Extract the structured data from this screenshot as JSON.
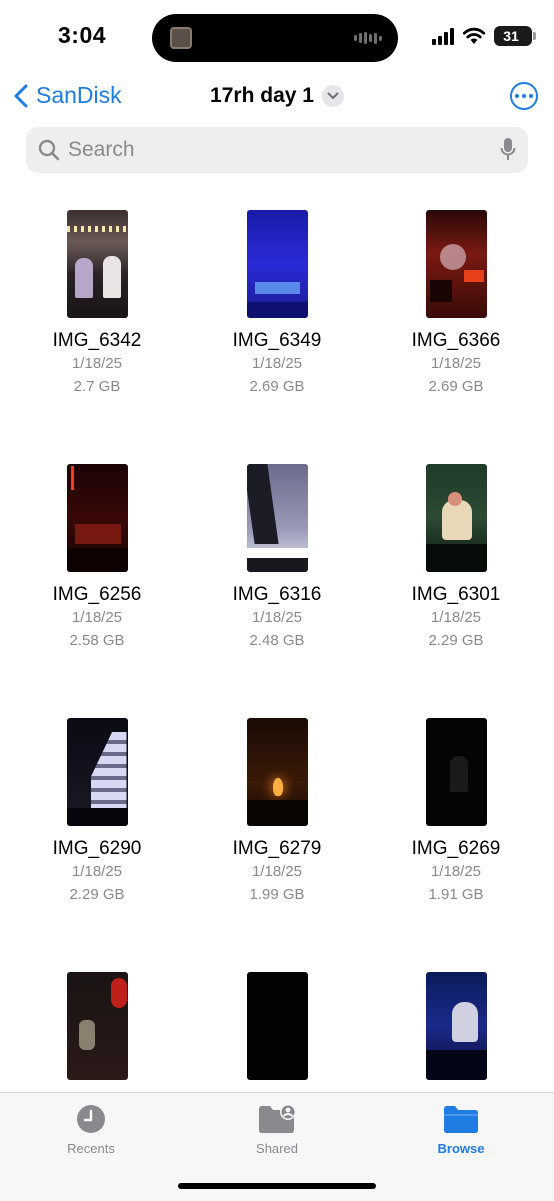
{
  "status_bar": {
    "time": "3:04",
    "battery": "31"
  },
  "nav": {
    "back_label": "SanDisk",
    "title": "17rh day 1"
  },
  "search": {
    "placeholder": "Search"
  },
  "files": [
    {
      "name": "IMG_6342",
      "date": "1/18/25",
      "size": "2.7 GB"
    },
    {
      "name": "IMG_6349",
      "date": "1/18/25",
      "size": "2.69 GB"
    },
    {
      "name": "IMG_6366",
      "date": "1/18/25",
      "size": "2.69 GB"
    },
    {
      "name": "IMG_6256",
      "date": "1/18/25",
      "size": "2.58 GB"
    },
    {
      "name": "IMG_6316",
      "date": "1/18/25",
      "size": "2.48 GB"
    },
    {
      "name": "IMG_6301",
      "date": "1/18/25",
      "size": "2.29 GB"
    },
    {
      "name": "IMG_6290",
      "date": "1/18/25",
      "size": "2.29 GB"
    },
    {
      "name": "IMG_6279",
      "date": "1/18/25",
      "size": "1.99 GB"
    },
    {
      "name": "IMG_6269",
      "date": "1/18/25",
      "size": "1.91 GB"
    },
    {
      "name": "",
      "date": "",
      "size": ""
    },
    {
      "name": "",
      "date": "",
      "size": ""
    },
    {
      "name": "",
      "date": "",
      "size": ""
    }
  ],
  "tabs": [
    {
      "label": "Recents",
      "icon": "clock-icon"
    },
    {
      "label": "Shared",
      "icon": "shared-folder-icon"
    },
    {
      "label": "Browse",
      "icon": "folder-icon"
    }
  ],
  "colors": {
    "accent": "#1f7ce0",
    "secondary_text": "#8a8a8e"
  }
}
